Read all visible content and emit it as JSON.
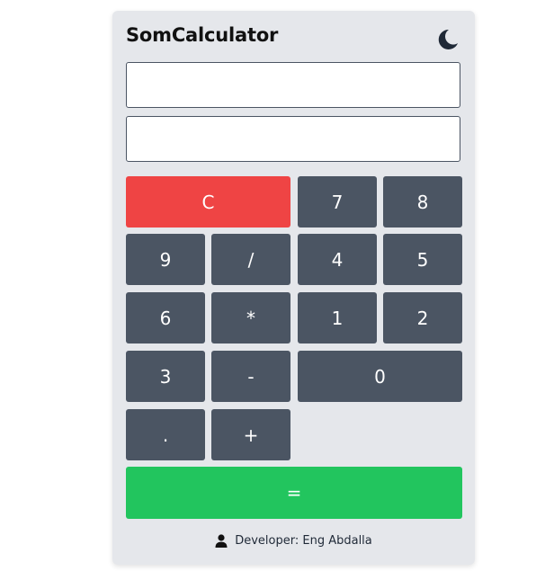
{
  "app": {
    "title": "SomCalculator",
    "theme_icon": "moon-icon"
  },
  "displays": {
    "expression_value": "",
    "result_value": ""
  },
  "buttons": {
    "clear": "C",
    "seven": "7",
    "eight": "8",
    "nine": "9",
    "divide": "/",
    "four": "4",
    "five": "5",
    "six": "6",
    "multiply": "*",
    "one": "1",
    "two": "2",
    "three": "3",
    "minus": "-",
    "zero": "0",
    "decimal": ".",
    "plus": "+",
    "equals": "="
  },
  "footer": {
    "icon": "user-icon",
    "text": "Developer: Eng Abdalla"
  },
  "colors": {
    "card_bg": "#e5e7eb",
    "key_bg": "#4b5563",
    "clear_bg": "#ef4444",
    "equals_bg": "#22c55e"
  }
}
